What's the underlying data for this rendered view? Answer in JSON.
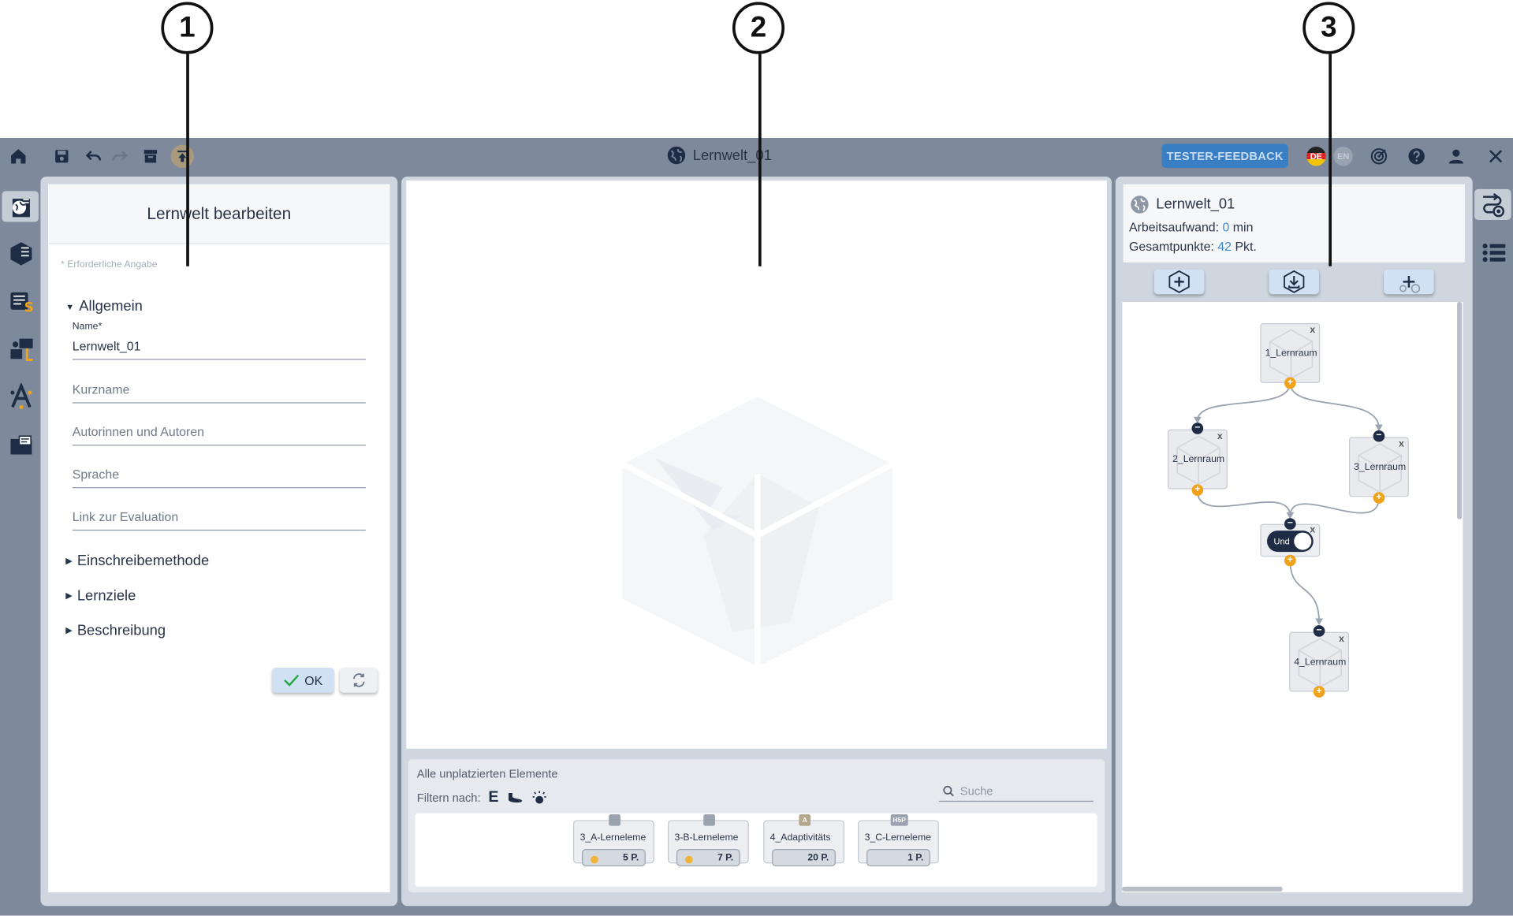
{
  "callouts": [
    "1",
    "2",
    "3"
  ],
  "toolbar": {
    "title": "Lernwelt_01",
    "feedback_label": "TESTER-FEEDBACK",
    "lang_de": "DE",
    "lang_en": "EN",
    "icons": [
      "home-icon",
      "save-icon",
      "undo-icon",
      "redo-icon",
      "archive-icon",
      "upload-icon",
      "globe-icon",
      "target-icon",
      "help-icon",
      "user-icon",
      "close-icon"
    ]
  },
  "left_sidebar": {
    "icons": [
      "world-edit-icon",
      "space-icon",
      "element-icon",
      "learning-path-icon",
      "adaptivity-icon",
      "folder-icon"
    ]
  },
  "edit_panel": {
    "title": "Lernwelt bearbeiten",
    "required_hint": "* Erforderliche Angabe",
    "section_general": "Allgemein",
    "name_label": "Name*",
    "name_value": "Lernwelt_01",
    "shortname_placeholder": "Kurzname",
    "authors_placeholder": "Autorinnen und Autoren",
    "language_placeholder": "Sprache",
    "evaluation_placeholder": "Link zur Evaluation",
    "section_enrolment": "Einschreibemethode",
    "section_goals": "Lernziele",
    "section_description": "Beschreibung",
    "ok_label": "OK"
  },
  "unplaced": {
    "title": "Alle unplatzierten Elemente",
    "filter_label": "Filtern nach:",
    "filter_letter": "E",
    "search_placeholder": "Suche",
    "items": [
      {
        "name": "3_A-Lerneleme",
        "points": "5 P.",
        "icon": "H5P"
      },
      {
        "name": "3-B-Lerneleme",
        "points": "7 P.",
        "icon": "H5P"
      },
      {
        "name": "4_Adaptivitäts",
        "points": "20 P.",
        "icon": "A"
      },
      {
        "name": "3_C-Lerneleme",
        "points": "1 P.",
        "icon": "H5P"
      }
    ]
  },
  "world_info": {
    "name": "Lernwelt_01",
    "workload_label": "Arbeitsaufwand:",
    "workload_value": "0",
    "workload_unit": "min",
    "points_label": "Gesamtpunkte:",
    "points_value": "42",
    "points_unit": "Pkt."
  },
  "graph": {
    "nodes": [
      "1_Lernraum",
      "2_Lernraum",
      "3_Lernraum",
      "4_Lernraum"
    ],
    "close_mark": "x",
    "condition_label": "Und"
  },
  "right_sidebar": {
    "icons": [
      "path-settings-icon",
      "list-icon"
    ]
  },
  "colors": {
    "frame": "#7e8a9b",
    "panel": "#cfd6df",
    "accent_blue": "#3a7fc4",
    "port_orange": "#f0a21b",
    "port_dark": "#1e2d45"
  }
}
